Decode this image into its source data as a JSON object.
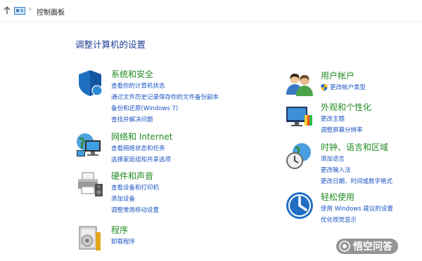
{
  "address": {
    "path": "控制面板"
  },
  "page_title": "调整计算机的设置",
  "categories": [
    {
      "title": "系统和安全",
      "links": [
        "查看你的计算机状态",
        "通过文件历史记录保存你的文件备份副本",
        "备份和还原(Windows 7)",
        "查找并解决问题"
      ]
    },
    {
      "title": "网络和 Internet",
      "links": [
        "查看网络状态和任务",
        "选择家庭组和共享选项"
      ]
    },
    {
      "title": "硬件和声音",
      "links": [
        "查看设备和打印机",
        "添加设备",
        "调整常用移动设置"
      ]
    },
    {
      "title": "程序",
      "links": [
        "卸载程序"
      ]
    },
    {
      "title": "用户帐户",
      "links": [
        "更改帐户类型"
      ]
    },
    {
      "title": "外观和个性化",
      "links": [
        "更改主题",
        "调整屏幕分辨率"
      ]
    },
    {
      "title": "时钟、语言和区域",
      "links": [
        "添加语言",
        "更改输入法",
        "更改日期、时间或数字格式"
      ]
    },
    {
      "title": "轻松使用",
      "links": [
        "使用 Windows 建议的设置",
        "优化视觉显示"
      ]
    }
  ],
  "watermark": "悟空问答",
  "colors": {
    "title_green": "#228b22",
    "link_blue": "#1c56c4",
    "heading_blue": "#1e3c94"
  }
}
